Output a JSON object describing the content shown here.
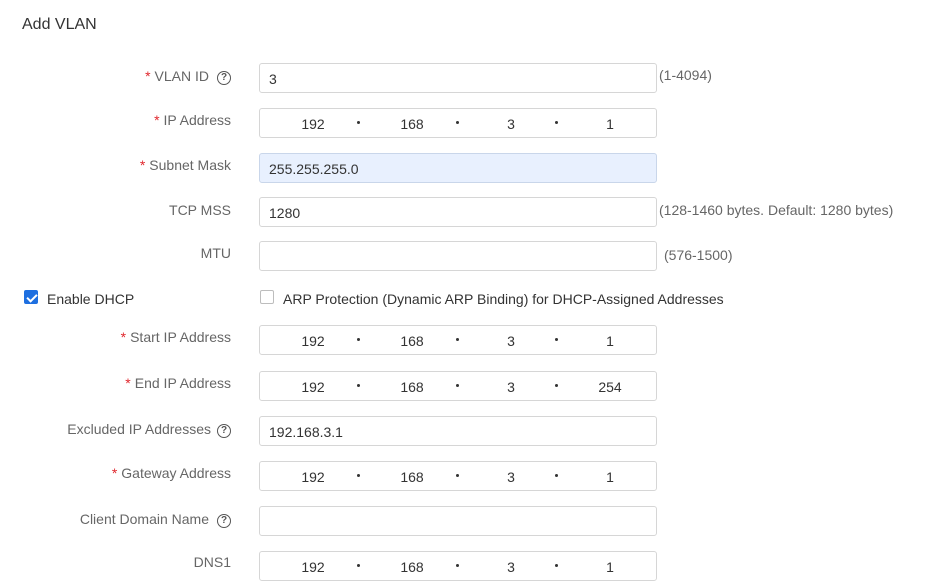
{
  "page": {
    "title": "Add VLAN"
  },
  "fields": {
    "vlan_id": {
      "label": "VLAN ID",
      "value": "3",
      "hint": "(1-4094)"
    },
    "ip_address": {
      "label": "IP Address",
      "octets": [
        "192",
        "168",
        "3",
        "1"
      ]
    },
    "subnet_mask": {
      "label": "Subnet Mask",
      "value": "255.255.255.0"
    },
    "tcp_mss": {
      "label": "TCP MSS",
      "value": "1280",
      "hint": "(128-1460 bytes. Default: 1280 bytes)"
    },
    "mtu": {
      "label": "MTU",
      "value": "",
      "hint": "(576-1500)"
    },
    "enable_dhcp": {
      "label": "Enable DHCP",
      "checked": true
    },
    "arp_protection": {
      "label": "ARP Protection (Dynamic ARP Binding) for DHCP-Assigned Addresses",
      "checked": false
    },
    "start_ip": {
      "label": "Start IP Address",
      "octets": [
        "192",
        "168",
        "3",
        "1"
      ]
    },
    "end_ip": {
      "label": "End IP Address",
      "octets": [
        "192",
        "168",
        "3",
        "254"
      ]
    },
    "excluded_ip": {
      "label": "Excluded IP Addresses",
      "value": "192.168.3.1"
    },
    "gateway": {
      "label": "Gateway Address",
      "octets": [
        "192",
        "168",
        "3",
        "1"
      ]
    },
    "client_domain": {
      "label": "Client Domain Name",
      "value": ""
    },
    "dns1": {
      "label": "DNS1",
      "octets": [
        "192",
        "168",
        "3",
        "1"
      ]
    }
  },
  "symbols": {
    "required": "*",
    "help": "?"
  },
  "colors": {
    "required": "#e0272d",
    "accent": "#1e6fe0",
    "autofill": "#e8f0fe"
  },
  "icons": {
    "help": "question-circle-icon",
    "check": "checkmark-icon"
  }
}
